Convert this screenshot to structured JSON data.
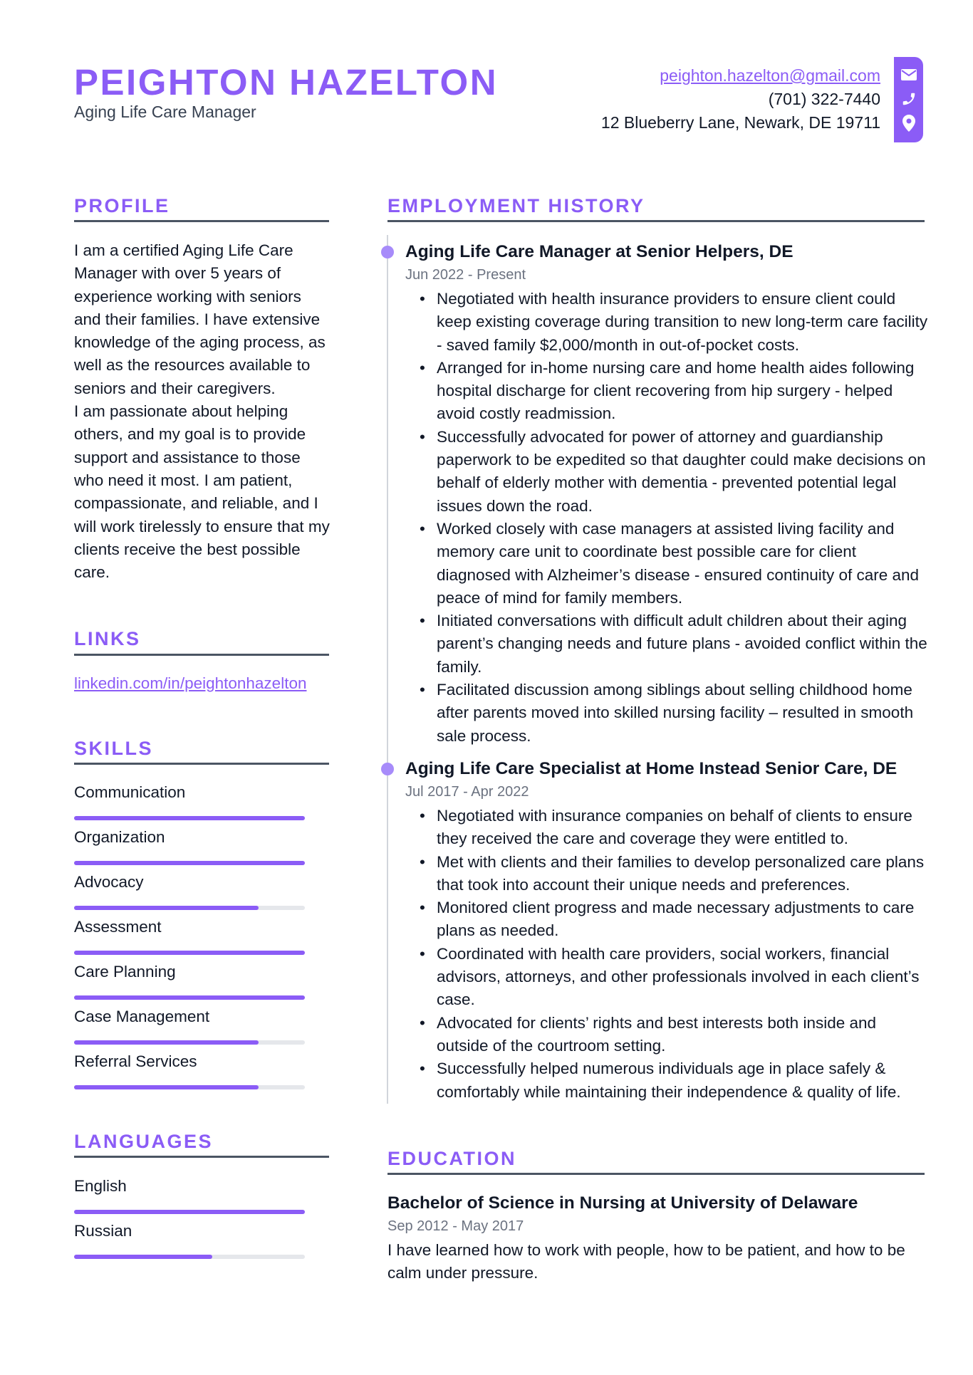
{
  "header": {
    "name": "PEIGHTON HAZELTON",
    "title": "Aging Life Care Manager",
    "email": "peighton.hazelton@gmail.com",
    "phone": "(701) 322-7440",
    "address": "12 Blueberry Lane, Newark, DE 19711",
    "icons": [
      "envelope-icon",
      "phone-icon",
      "location-pin-icon"
    ]
  },
  "colors": {
    "accent": "#8b5cf6",
    "rule": "#4b5563",
    "track": "#e5e7eb",
    "muted": "#6b7280"
  },
  "profile": {
    "heading": "PROFILE",
    "text_1": "I am a certified Aging Life Care Manager with over 5 years of experience working with seniors and their families. I have extensive knowledge of the aging process, as well as the resources available to seniors and their caregivers.",
    "text_2": "I am passionate about helping others, and my goal is to provide support and assistance to those who need it most. I am patient, compassionate, and reliable, and I will work tirelessly to ensure that my clients receive the best possible care."
  },
  "links": {
    "heading": "LINKS",
    "items": [
      {
        "label": "linkedin.com/in/peightonhazelton"
      }
    ]
  },
  "skills": {
    "heading": "SKILLS",
    "items": [
      {
        "label": "Communication",
        "level": 1.0
      },
      {
        "label": "Organization",
        "level": 1.0
      },
      {
        "label": "Advocacy",
        "level": 0.8
      },
      {
        "label": "Assessment",
        "level": 1.0
      },
      {
        "label": "Care Planning",
        "level": 1.0
      },
      {
        "label": "Case Management",
        "level": 0.8
      },
      {
        "label": "Referral Services",
        "level": 0.8
      }
    ]
  },
  "languages": {
    "heading": "LANGUAGES",
    "items": [
      {
        "label": "English",
        "level": 1.0
      },
      {
        "label": "Russian",
        "level": 0.6
      }
    ]
  },
  "employment": {
    "heading": "EMPLOYMENT HISTORY",
    "jobs": [
      {
        "title": "Aging Life Care Manager at Senior Helpers, DE",
        "dates": "Jun 2022 - Present",
        "bullets": [
          "Negotiated with health insurance providers to ensure client could keep existing coverage during transition to new long-term care facility - saved family $2,000/month in out-of-pocket costs.",
          "Arranged for in-home nursing care and home health aides following hospital discharge for client recovering from hip surgery - helped avoid costly readmission.",
          "Successfully advocated for power of attorney and guardianship paperwork to be expedited so that daughter could make decisions on behalf of elderly mother with dementia - prevented potential legal issues down the road.",
          "Worked closely with case managers at assisted living facility and memory care unit to coordinate best possible care for client diagnosed with Alzheimer’s disease - ensured continuity of care and peace of mind for family members.",
          "Initiated conversations with difficult adult children about their aging parent’s changing needs and future plans - avoided conflict within the family.",
          "Facilitated discussion among siblings about selling childhood home after parents moved into skilled nursing facility – resulted in smooth sale process."
        ]
      },
      {
        "title": "Aging Life Care Specialist at Home Instead Senior Care, DE",
        "dates": "Jul 2017 - Apr 2022",
        "bullets": [
          "Negotiated with insurance companies on behalf of clients to ensure they received the care and coverage they were entitled to.",
          "Met with clients and their families to develop personalized care plans that took into account their unique needs and preferences.",
          "Monitored client progress and made necessary adjustments to care plans as needed.",
          "Coordinated with health care providers, social workers, financial advisors, attorneys, and other professionals involved in each client’s case.",
          "Advocated for clients’ rights and best interests both inside and outside of the courtroom setting.",
          "Successfully helped numerous individuals age in place safely & comfortably while maintaining their independence & quality of life."
        ]
      }
    ]
  },
  "education": {
    "heading": "EDUCATION",
    "items": [
      {
        "title": "Bachelor of Science in Nursing at University of Delaware",
        "dates": "Sep 2012 - May 2017",
        "description": "I have learned how to work with people, how to be patient, and how to be calm under pressure."
      }
    ]
  }
}
